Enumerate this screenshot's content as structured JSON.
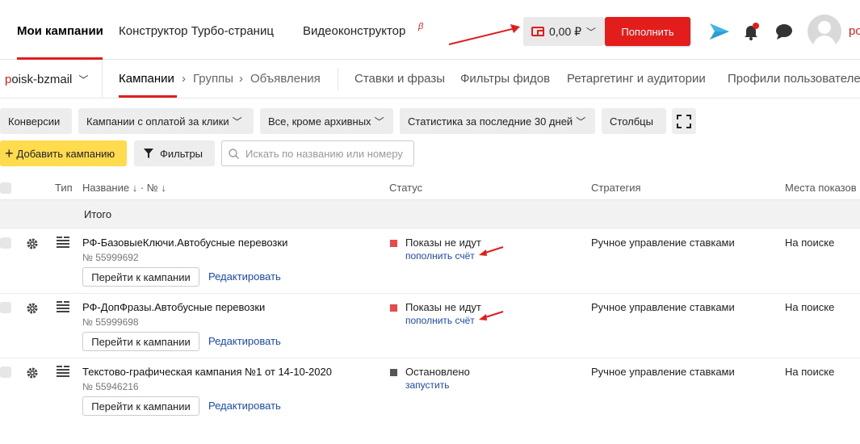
{
  "top_nav": {
    "tabs": [
      "Мои кампании",
      "Конструктор Турбо-страниц",
      "Видеоконструктор"
    ],
    "beta_mark": "β",
    "balance": "0,00 ₽",
    "topup_label": "Пополнить",
    "user_initials": "po"
  },
  "sub_nav": {
    "login_first": "p",
    "login_rest": "oisk-bzmail",
    "breadcrumbs": [
      "Кампании",
      "›",
      "Группы",
      "›",
      "Объявления"
    ],
    "tabs": [
      "Ставки и фразы",
      "Фильтры фидов",
      "Ретаргетинг и аудитории",
      "Профили пользователе"
    ]
  },
  "filters": {
    "conversions": "Конверсии",
    "payment": "Кампании с оплатой за клики",
    "archive": "Все, кроме архивных",
    "stats": "Статистика за последние 30 дней",
    "columns": "Столбцы"
  },
  "toolbar": {
    "add_label": "Добавить кампанию",
    "filters_label": "Фильтры",
    "search_placeholder": "Искать по названию или номеру"
  },
  "table": {
    "headers": {
      "type": "Тип",
      "name": "Название ↓ · № ↓",
      "status": "Статус",
      "strategy": "Стратегия",
      "places": "Места показов"
    },
    "total_label": "Итого",
    "go_label": "Перейти к кампании",
    "edit_label": "Редактировать",
    "rows": [
      {
        "name": "РФ-БазовыеКлючи.Автобусные перевозки",
        "number": "№ 55999692",
        "status": "Показы не идут",
        "status_color": "#e84a4a",
        "action": "пополнить счёт",
        "strategy": "Ручное управление ставками",
        "places": "На поиске"
      },
      {
        "name": "РФ-ДопФразы.Автобусные перевозки",
        "number": "№ 55999698",
        "status": "Показы не идут",
        "status_color": "#e84a4a",
        "action": "пополнить счёт",
        "strategy": "Ручное управление ставками",
        "places": "На поиске"
      },
      {
        "name": "Текстово-графическая кампания №1 от 14-10-2020",
        "number": "№ 55946216",
        "status": "Остановлено",
        "status_color": "#555555",
        "action": "запустить",
        "strategy": "Ручное управление ставками",
        "places": "На поиске"
      }
    ]
  },
  "colors": {
    "accent_red": "#e31c1c",
    "add_yellow": "#ffdb4d",
    "link_blue": "#1a4ab4"
  },
  "icons": [
    "wallet-icon",
    "send-icon",
    "bell-icon",
    "chat-icon",
    "avatar",
    "fullscreen-icon",
    "plus-icon",
    "filter-icon",
    "search-icon",
    "gear-icon",
    "list-icon"
  ]
}
